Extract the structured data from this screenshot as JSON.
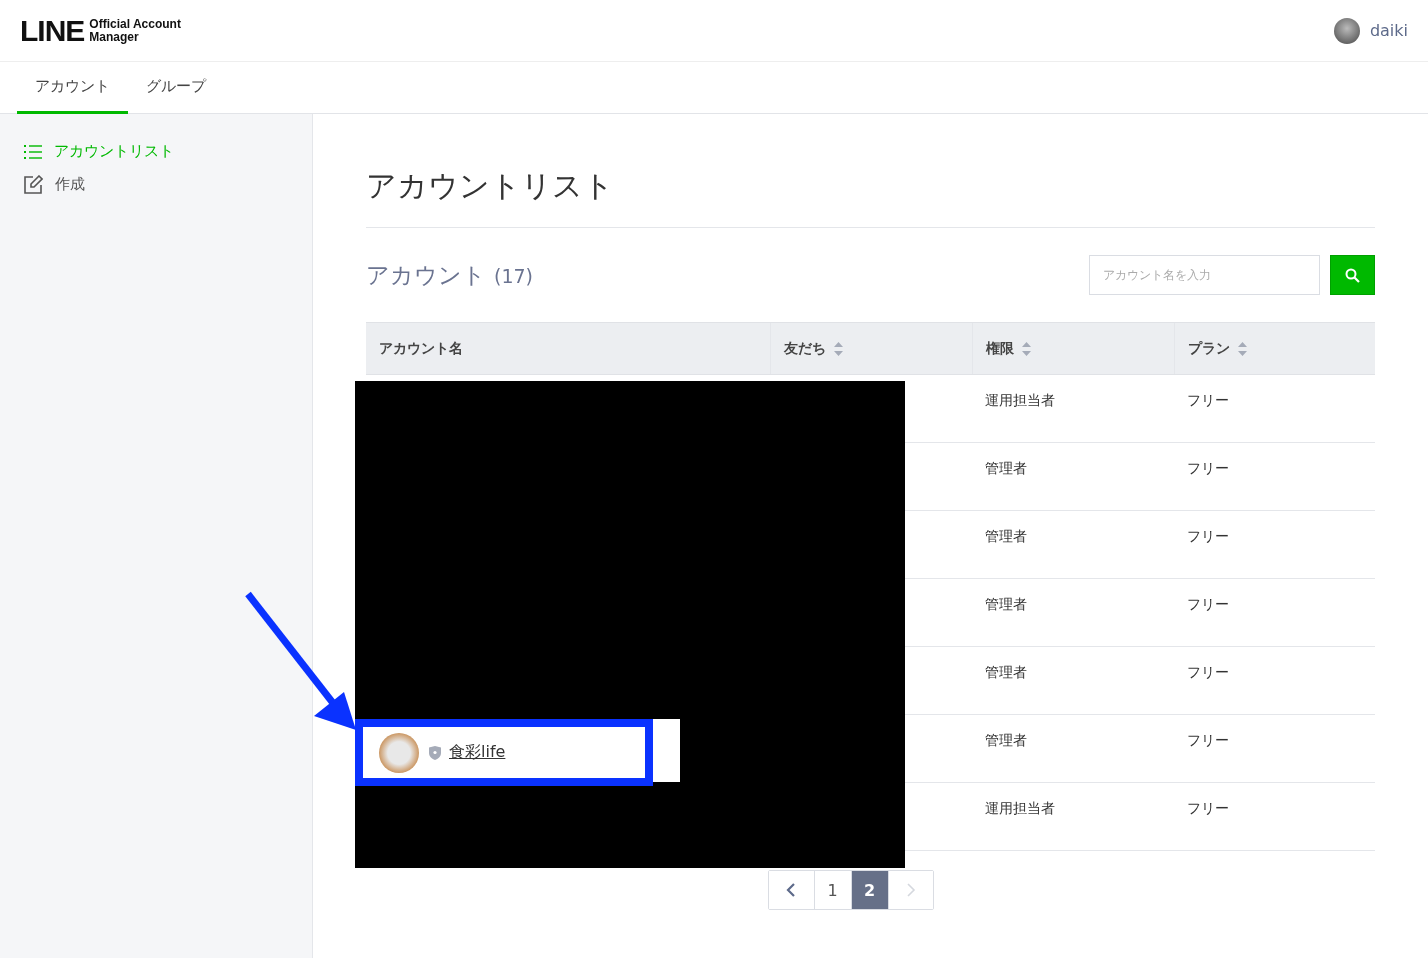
{
  "header": {
    "logo_mark": "LINE",
    "logo_line_1": "Official Account",
    "logo_line_2": "Manager",
    "user_name": "daiki"
  },
  "tabs": [
    {
      "label": "アカウント",
      "selected": true
    },
    {
      "label": "グループ",
      "selected": false
    }
  ],
  "sidebar": {
    "items": [
      {
        "label": "アカウントリスト",
        "kind": "list",
        "selected": true
      },
      {
        "label": "作成",
        "kind": "edit",
        "selected": false
      }
    ]
  },
  "page_title": "アカウントリスト",
  "section": {
    "title": "アカウント",
    "count": "(17)"
  },
  "search": {
    "placeholder": "アカウント名を入力"
  },
  "table": {
    "columns": [
      {
        "label": "アカウント名",
        "sortable": false
      },
      {
        "label": "友だち",
        "sortable": true
      },
      {
        "label": "権限",
        "sortable": true
      },
      {
        "label": "プラン",
        "sortable": true
      }
    ],
    "rows": [
      {
        "role": "運用担当者",
        "plan": "フリー"
      },
      {
        "role": "管理者",
        "plan": "フリー"
      },
      {
        "role": "管理者",
        "plan": "フリー"
      },
      {
        "role": "管理者",
        "plan": "フリー"
      },
      {
        "role": "管理者",
        "plan": "フリー"
      },
      {
        "name": "食彩life",
        "role": "管理者",
        "plan": "フリー",
        "highlighted": true
      },
      {
        "role": "運用担当者",
        "plan": "フリー"
      }
    ]
  },
  "pagination": {
    "pages": [
      {
        "label": "1",
        "selected": false
      },
      {
        "label": "2",
        "selected": true
      }
    ],
    "prev_disabled": false,
    "next_disabled": true
  }
}
